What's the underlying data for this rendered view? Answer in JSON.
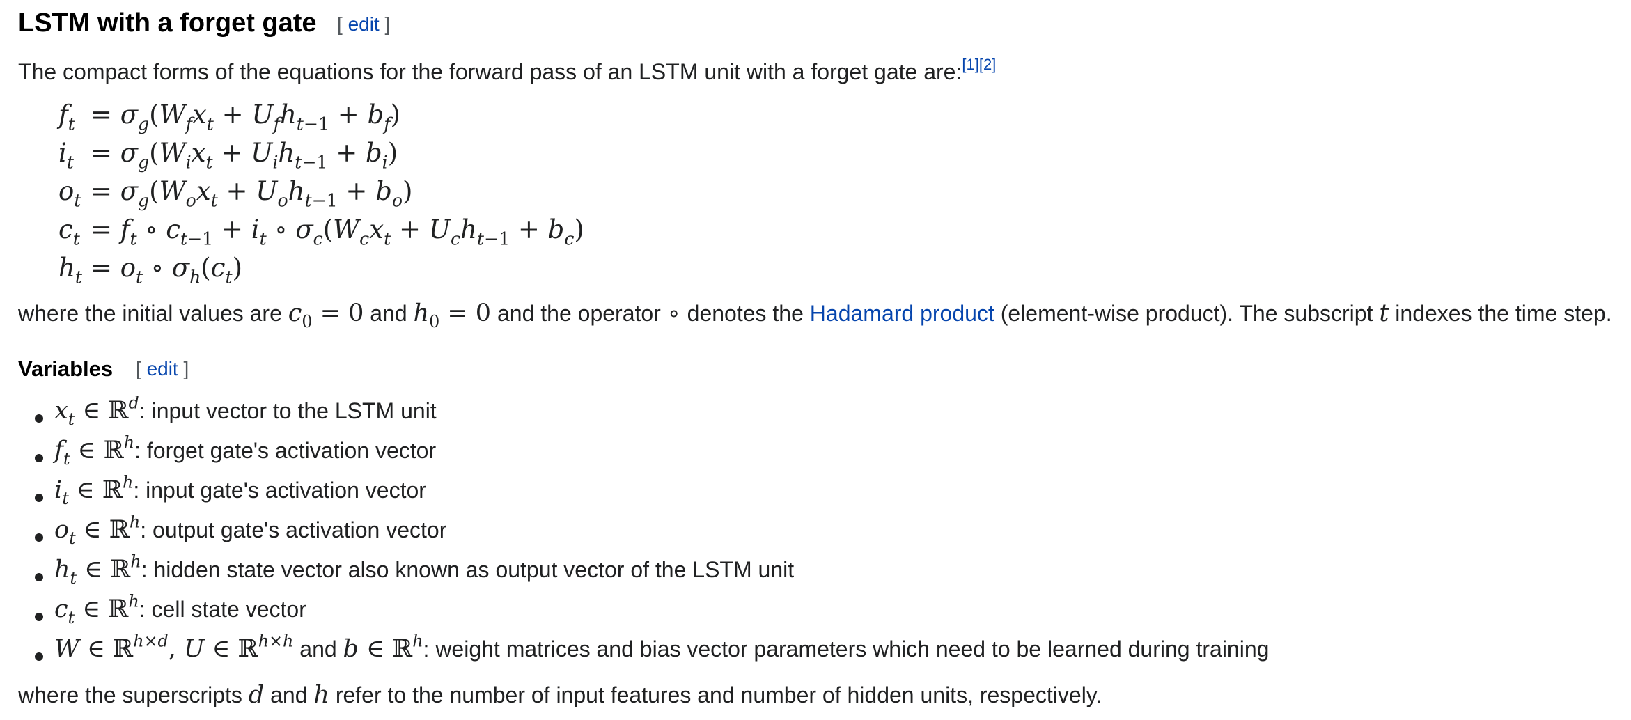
{
  "section": {
    "title": "LSTM with a forget gate",
    "edit_label": "edit",
    "intro": "The compact forms of the equations for the forward pass of an LSTM unit with a forget gate are:",
    "refs": [
      "[1]",
      "[2]"
    ],
    "after_eq": {
      "part1": "where the initial values are",
      "part2": "and",
      "part3": "and the operator ∘ denotes the",
      "link": "Hadamard product",
      "part4": "(element-wise product). The subscript",
      "part5": "indexes the time step."
    }
  },
  "variables": {
    "title": "Variables",
    "edit_label": "edit",
    "items": [
      ": input vector to the LSTM unit",
      ": forget gate's activation vector",
      ": input gate's activation vector",
      ": output gate's activation vector",
      ": hidden state vector also known as output vector of the LSTM unit",
      ": cell state vector",
      ": weight matrices and bias vector parameters which need to be learned during training"
    ],
    "last_item_and": "and",
    "footer_part1": "where the superscripts",
    "footer_part2": "and",
    "footer_part3": "refer to the number of input features and number of hidden units, respectively."
  }
}
